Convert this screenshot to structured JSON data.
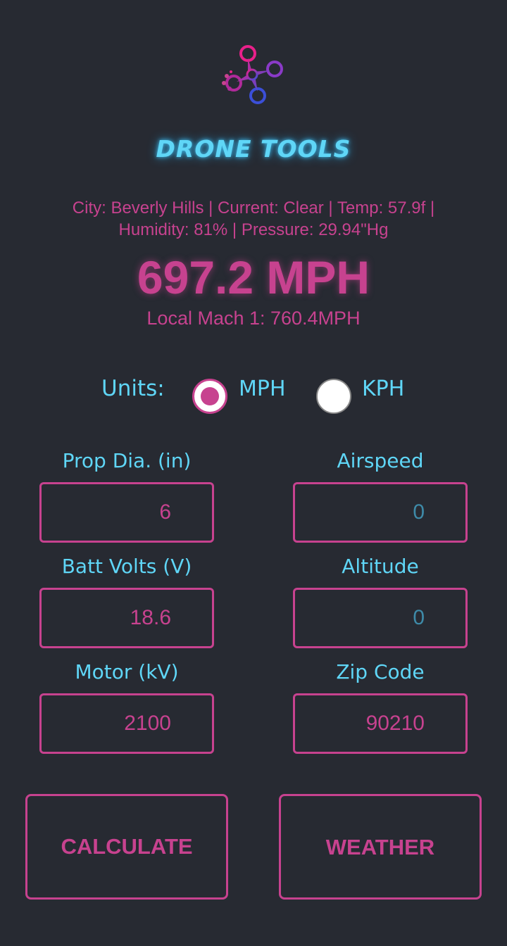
{
  "app": {
    "title": "DRONE TOOLS"
  },
  "weather": {
    "line1": "City: Beverly Hills | Current: Clear | Temp: 57.9f |",
    "line2": "Humidity: 81% | Pressure: 29.94\"Hg"
  },
  "result": {
    "speed": "697.2 MPH",
    "mach": "Local Mach 1: 760.4MPH"
  },
  "units": {
    "label": "Units:",
    "options": [
      {
        "label": "MPH",
        "selected": true
      },
      {
        "label": "KPH",
        "selected": false
      }
    ]
  },
  "fields": {
    "prop": {
      "label": "Prop Dia. (in)",
      "value": "6",
      "placeholder": ""
    },
    "airspeed": {
      "label": "Airspeed",
      "value": "",
      "placeholder": "0"
    },
    "volts": {
      "label": "Batt Volts (V)",
      "value": "18.6",
      "placeholder": ""
    },
    "altitude": {
      "label": "Altitude",
      "value": "",
      "placeholder": "0"
    },
    "motor": {
      "label": "Motor (kV)",
      "value": "2100",
      "placeholder": ""
    },
    "zip": {
      "label": "Zip Code",
      "value": "90210",
      "placeholder": ""
    }
  },
  "buttons": {
    "calculate": "CALCULATE",
    "weather": "WEATHER"
  },
  "colors": {
    "background": "#272a32",
    "accent": "#c7428f",
    "cyan": "#5fd6f7"
  },
  "icons": {
    "logo": "drone-logo-icon"
  }
}
